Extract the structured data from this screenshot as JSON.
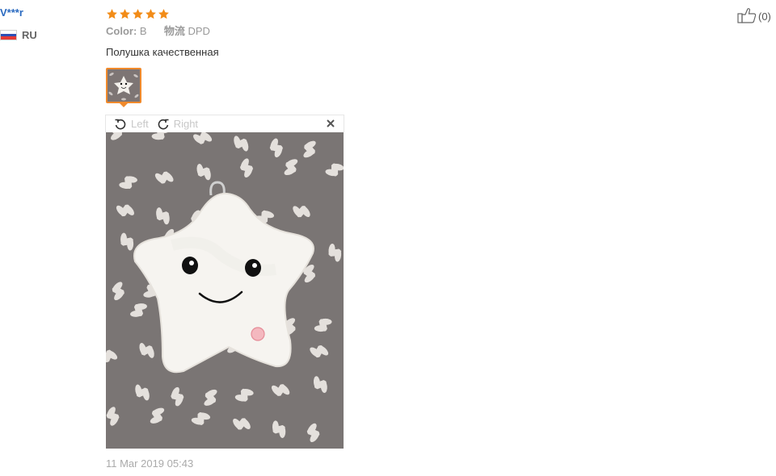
{
  "reviewer": {
    "name": "V***r",
    "country_code": "RU",
    "flag_colors": [
      "#ffffff",
      "#2d4fb5",
      "#e53a35"
    ]
  },
  "review": {
    "rating": 5,
    "max_rating": 5,
    "star_color": "#f28c18",
    "color_label": "Color:",
    "color_value": "B",
    "logistics_label": "物流",
    "logistics_value": "DPD",
    "text": "Полушка качественная",
    "date": "11 Mar 2019 05:43"
  },
  "viewer": {
    "rotate_left_label": "Left",
    "rotate_right_label": "Right",
    "close_icon": "close-icon"
  },
  "helpful": {
    "icon": "thumbs-up-icon",
    "count_text": "(0)"
  },
  "colors": {
    "username": "#2a6ac0",
    "thumb_border": "#f08a2c"
  }
}
